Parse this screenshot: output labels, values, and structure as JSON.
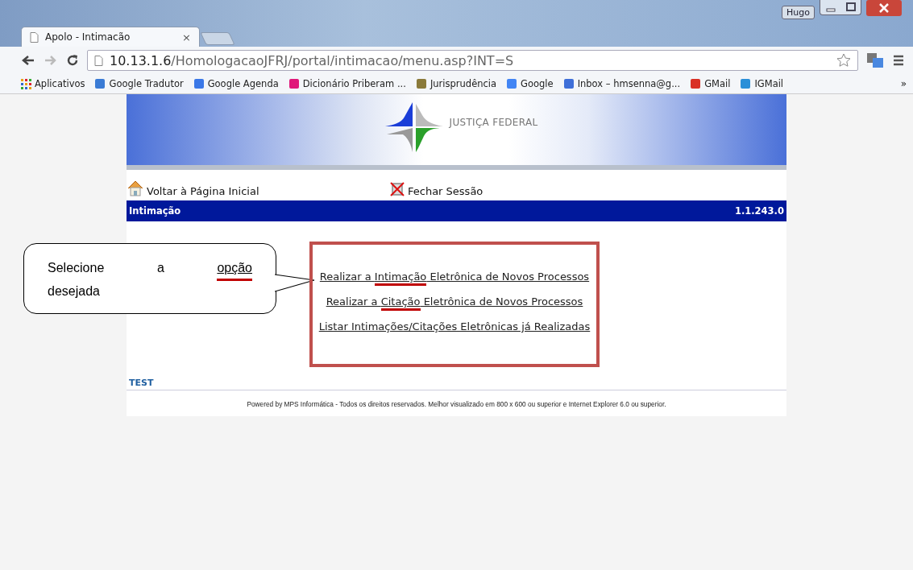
{
  "window": {
    "user": "Hugo"
  },
  "tabs": [
    {
      "label": "Apolo - Intimacão",
      "selected": true,
      "close": "×"
    }
  ],
  "address_bar": {
    "host": "10.13.1.6",
    "path": "/HomologacaoJFRJ/portal/intimacao/menu.asp?INT=S"
  },
  "bookmarks": [
    {
      "label": "Aplicativos",
      "kind": "apps"
    },
    {
      "label": "Google Tradutor",
      "kind": "translate"
    },
    {
      "label": "Google Agenda",
      "kind": "calendar"
    },
    {
      "label": "Dicionário Priberam ...",
      "kind": "dictionary"
    },
    {
      "label": "Jurisprudência",
      "kind": "picture"
    },
    {
      "label": "Google",
      "kind": "google"
    },
    {
      "label": "Inbox – hmsenna@g...",
      "kind": "inbox"
    },
    {
      "label": "GMail",
      "kind": "gmail"
    },
    {
      "label": "IGMail",
      "kind": "ie"
    }
  ],
  "bookmarks_more": "»",
  "banner": {
    "title": "JUSTIÇA FEDERAL"
  },
  "nav_links": [
    {
      "label": "Voltar à Página Inicial",
      "kind": "home"
    },
    {
      "label": "Fechar Sessão",
      "kind": "close"
    }
  ],
  "title_bar": {
    "title": "Intimação",
    "version": "1.1.243.0"
  },
  "callout": {
    "lines": [
      [
        {
          "text": "Selecione",
          "marked": false
        },
        {
          "text": "a",
          "marked": false
        },
        {
          "text": "opção",
          "marked": true
        }
      ],
      [
        {
          "text": "desejada",
          "marked": false
        }
      ]
    ]
  },
  "options": [
    [
      {
        "text": "Realizar a ",
        "marked": false
      },
      {
        "text": "Intimação",
        "marked": true
      },
      {
        "text": " Eletrônica de Novos Processos",
        "marked": false
      }
    ],
    [
      {
        "text": "Realizar a ",
        "marked": false
      },
      {
        "text": "Citação",
        "marked": true
      },
      {
        "text": " Eletrônica de Novos Processos",
        "marked": false
      }
    ],
    [
      {
        "text": "Listar Intimações/Citações Eletrônicas já Realizadas",
        "marked": false
      }
    ]
  ],
  "environment": "TEST",
  "footer": "Powered by MPS Informática - Todos os direitos reservados. Melhor visualizado em 800 x 600 ou superior e Internet Explorer 6.0 ou superior."
}
